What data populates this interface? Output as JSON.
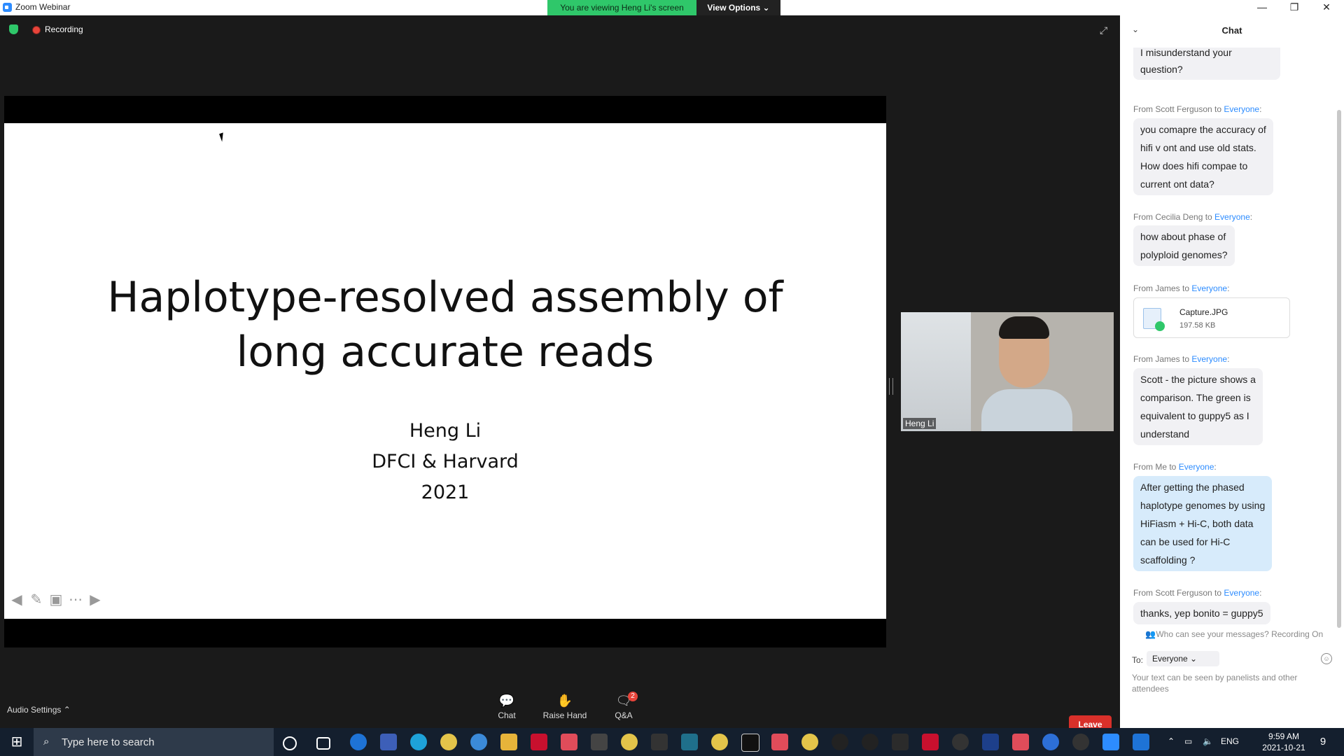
{
  "window": {
    "app_title": "Zoom Webinar",
    "banner": "You are viewing Heng Li's screen",
    "view_options": "View Options ⌄",
    "controls": [
      "—",
      "❐",
      "✕"
    ]
  },
  "meeting": {
    "recording_label": "Recording",
    "slide": {
      "title_line1": "Haplotype-resolved assembly of",
      "title_line2": "long accurate reads",
      "author": "Heng Li",
      "affiliation": "DFCI & Harvard",
      "year": "2021"
    },
    "video": {
      "name": "Heng Li"
    },
    "toolbar": {
      "audio_settings": "Audio Settings ⌃",
      "chat": "Chat",
      "raise_hand": "Raise Hand",
      "qa": "Q&A",
      "qa_badge": "2",
      "leave": "Leave"
    }
  },
  "chat": {
    "title": "Chat",
    "partial_message": "I misunderstand your question?",
    "messages": [
      {
        "from": "From Scott Ferguson to ",
        "to": "Everyone",
        "text_lines": [
          "you comapre the accuracy of",
          "hifi v ont and use old stats.",
          "How does hifi compae to",
          "current ont data?"
        ]
      },
      {
        "from": "From Cecilia Deng to ",
        "to": "Everyone",
        "text_lines": [
          "how about phase of",
          "polyploid genomes?"
        ]
      },
      {
        "from": "From James to ",
        "to": "Everyone",
        "file_name": "Capture.JPG",
        "file_size": "197.58 KB"
      },
      {
        "from": "From James to ",
        "to": "Everyone",
        "text_lines": [
          "Scott - the picture shows a",
          "comparison. The green is",
          "equivalent to guppy5 as I",
          "understand"
        ]
      },
      {
        "from": "From Me to ",
        "to": "Everyone",
        "text_lines": [
          "After getting the phased",
          "haplotype genomes by using",
          "HiFiasm + Hi-C, both data",
          "can be used for Hi-C",
          "scaffolding ?"
        ]
      },
      {
        "from": "From Scott Ferguson to ",
        "to": "Everyone",
        "text_lines": [
          "thanks, yep bonito = guppy5"
        ]
      }
    ],
    "privacy": "Who can see your messages? Recording On",
    "to_label": "To:",
    "to_value": "Everyone ⌄",
    "input_placeholder": "Your text can be seen by panelists and other attendees"
  },
  "taskbar": {
    "search_placeholder": "Type here to search",
    "language": "ENG",
    "time": "9:59 AM",
    "date": "2021-10-21",
    "notifications": "9"
  }
}
